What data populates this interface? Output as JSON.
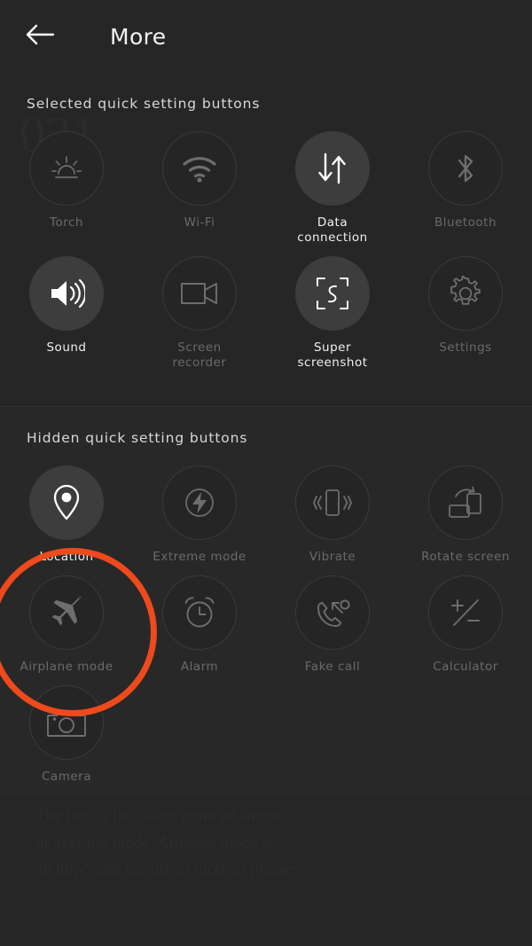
{
  "header": {
    "title": "More",
    "back_icon": "back-arrow-icon"
  },
  "sections": [
    {
      "id": "selected",
      "title": "Selected quick setting buttons",
      "tiles": [
        {
          "label": "Torch",
          "icon": "torch-icon",
          "state": "inactive"
        },
        {
          "label": "Wi-Fi",
          "icon": "wifi-icon",
          "state": "inactive"
        },
        {
          "label": "Data connection",
          "icon": "data-connection-icon",
          "state": "active"
        },
        {
          "label": "Bluetooth",
          "icon": "bluetooth-icon",
          "state": "inactive"
        },
        {
          "label": "Sound",
          "icon": "sound-icon",
          "state": "active"
        },
        {
          "label": "Screen recorder",
          "icon": "screen-recorder-icon",
          "state": "inactive"
        },
        {
          "label": "Super screenshot",
          "icon": "super-screenshot-icon",
          "state": "active"
        },
        {
          "label": "Settings",
          "icon": "settings-gear-icon",
          "state": "inactive"
        }
      ]
    },
    {
      "id": "hidden",
      "title": "Hidden quick setting buttons",
      "tiles": [
        {
          "label": "Location",
          "icon": "location-pin-icon",
          "state": "active"
        },
        {
          "label": "Extreme mode",
          "icon": "extreme-mode-icon",
          "state": "inactive"
        },
        {
          "label": "Vibrate",
          "icon": "vibrate-icon",
          "state": "inactive"
        },
        {
          "label": "Rotate screen",
          "icon": "rotate-screen-icon",
          "state": "inactive"
        },
        {
          "label": "Airplane mode",
          "icon": "airplane-icon",
          "state": "inactive"
        },
        {
          "label": "Alarm",
          "icon": "alarm-clock-icon",
          "state": "inactive"
        },
        {
          "label": "Fake call",
          "icon": "fake-call-icon",
          "state": "inactive"
        },
        {
          "label": "Calculator",
          "icon": "calculator-icon",
          "state": "inactive"
        },
        {
          "label": "Camera",
          "icon": "camera-icon",
          "state": "inactive"
        }
      ]
    }
  ],
  "annotation": {
    "target_label": "Airplane mode",
    "color": "#ef4a1c",
    "shape": "circle"
  },
  "colors": {
    "background": "#262626",
    "tile_active_fill": "#3d3d3d",
    "tile_inactive_ring": "#3a3a3a",
    "label_active": "#f0f0f0",
    "label_inactive": "#6a6a6a",
    "accent": "#ef4a1c"
  }
}
